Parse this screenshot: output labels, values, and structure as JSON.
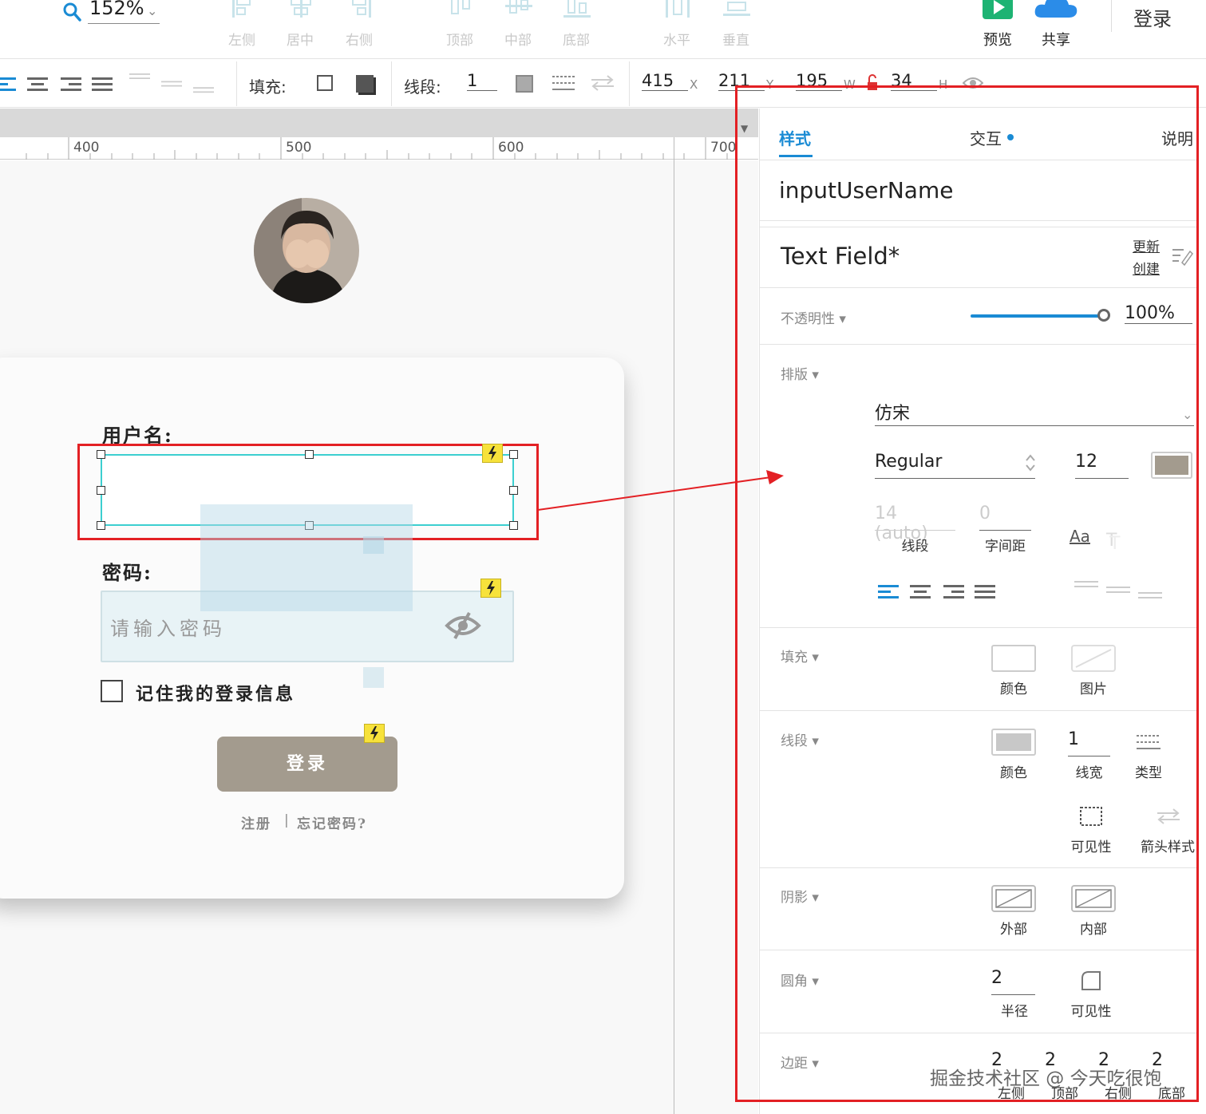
{
  "toolbar": {
    "zoom": "152%",
    "align_buttons": [
      "左侧",
      "居中",
      "右侧",
      "顶部",
      "中部",
      "底部",
      "水平",
      "垂直"
    ],
    "preview_label": "预览",
    "share_label": "共享",
    "login_label": "登录",
    "colors": {
      "preview": "#1db373",
      "share": "#2b8ce8",
      "disabled": "#c8e3ea"
    }
  },
  "formatbar": {
    "fill_label": "填充:",
    "stroke_label": "线段:",
    "stroke_width": "1",
    "x": "415",
    "x_unit": "X",
    "y": "211",
    "y_unit": "Y",
    "w": "195",
    "w_unit": "W",
    "h": "34",
    "h_unit": "H"
  },
  "ruler": {
    "ticks": [
      "400",
      "500",
      "600",
      "700"
    ]
  },
  "form": {
    "username_label": "用户名:",
    "password_label": "密码:",
    "password_placeholder": "请输入密码",
    "remember_label": "记住我的登录信息",
    "login_button": "登录",
    "register_link": "注册",
    "divider": "|",
    "forgot_link": "忘记密码?"
  },
  "panel": {
    "tabs": {
      "style": "样式",
      "interaction": "交互",
      "notes": "说明"
    },
    "element_name": "inputUserName",
    "style_name": "Text Field*",
    "update_link": "更新",
    "create_link": "创建",
    "opacity_label": "不透明性 ▾",
    "opacity_value": "100%",
    "opacity_level": 1.0,
    "typography_label": "排版 ▾",
    "font_family": "仿宋",
    "font_weight": "Regular",
    "font_size": "12",
    "font_color": "#a39b8e",
    "line_height": "14 (auto)",
    "line_height_caption": "线段",
    "letter_spacing": "0",
    "letter_spacing_caption": "字间距",
    "case_icon": "Aa",
    "fill_label": "填充 ▾",
    "fill_color_caption": "颜色",
    "fill_image_caption": "图片",
    "stroke_label": "线段 ▾",
    "stroke_color_caption": "颜色",
    "stroke_width": "1",
    "stroke_width_caption": "线宽",
    "stroke_type_caption": "类型",
    "visibility_caption": "可见性",
    "arrow_caption": "箭头样式",
    "shadow_label": "阴影 ▾",
    "shadow_outer_caption": "外部",
    "shadow_inner_caption": "内部",
    "corner_label": "圆角 ▾",
    "corner_radius": "2",
    "corner_radius_caption": "半径",
    "corner_visibility_caption": "可见性",
    "padding_label": "边距 ▾",
    "padding_values": [
      "2",
      "2",
      "2",
      "2"
    ],
    "padding_captions": [
      "左侧",
      "顶部",
      "右侧",
      "底部"
    ]
  },
  "watermark": "掘金技术社区 @ 今天吃很饱"
}
